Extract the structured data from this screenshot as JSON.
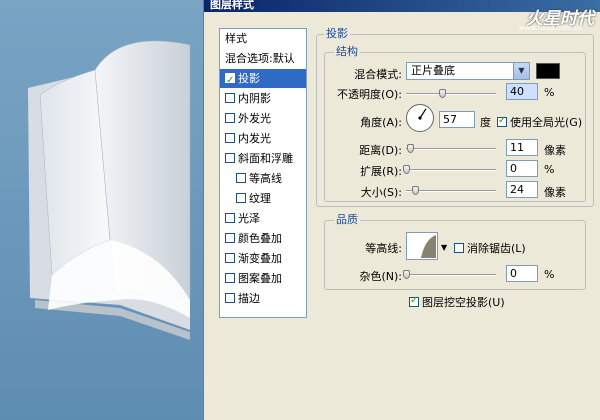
{
  "dialog": {
    "title": "图层样式",
    "watermark_logo": "火星时代",
    "watermark_url": "www.hxsd.com.cn"
  },
  "style_list": {
    "header": "样式",
    "blend_options": "混合选项:默认",
    "items": [
      {
        "label": "投影",
        "checked": true,
        "selected": true
      },
      {
        "label": "内阴影",
        "checked": false,
        "selected": false
      },
      {
        "label": "外发光",
        "checked": false,
        "selected": false
      },
      {
        "label": "内发光",
        "checked": false,
        "selected": false
      },
      {
        "label": "斜面和浮雕",
        "checked": false,
        "selected": false
      },
      {
        "label": "等高线",
        "checked": false,
        "selected": false,
        "sub": true
      },
      {
        "label": "纹理",
        "checked": false,
        "selected": false,
        "sub": true
      },
      {
        "label": "光泽",
        "checked": false,
        "selected": false
      },
      {
        "label": "颜色叠加",
        "checked": false,
        "selected": false
      },
      {
        "label": "渐变叠加",
        "checked": false,
        "selected": false
      },
      {
        "label": "图案叠加",
        "checked": false,
        "selected": false
      },
      {
        "label": "描边",
        "checked": false,
        "selected": false
      }
    ]
  },
  "panel": {
    "title": "投影",
    "structure": {
      "label": "结构",
      "blend_mode_label": "混合模式:",
      "blend_mode_value": "正片叠底",
      "shadow_color": "#000000",
      "opacity_label": "不透明度(O):",
      "opacity_value": "40",
      "opacity_unit": "%",
      "opacity_level": 0.4,
      "angle_label": "角度(A):",
      "angle_value": "57",
      "angle_unit": "度",
      "global_light_label": "使用全局光(G)",
      "global_light_checked": true,
      "distance_label": "距离(D):",
      "distance_value": "11",
      "distance_unit": "像素",
      "distance_level": 0.04,
      "spread_label": "扩展(R):",
      "spread_value": "0",
      "spread_unit": "%",
      "spread_level": 0.0,
      "size_label": "大小(S):",
      "size_value": "24",
      "size_unit": "像素",
      "size_level": 0.1
    },
    "quality": {
      "label": "品质",
      "contour_label": "等高线:",
      "antialias_label": "消除锯齿(L)",
      "antialias_checked": false,
      "noise_label": "杂色(N):",
      "noise_value": "0",
      "noise_unit": "%",
      "noise_level": 0.0
    },
    "knockout_label": "图层挖空投影(U)",
    "knockout_checked": true
  }
}
